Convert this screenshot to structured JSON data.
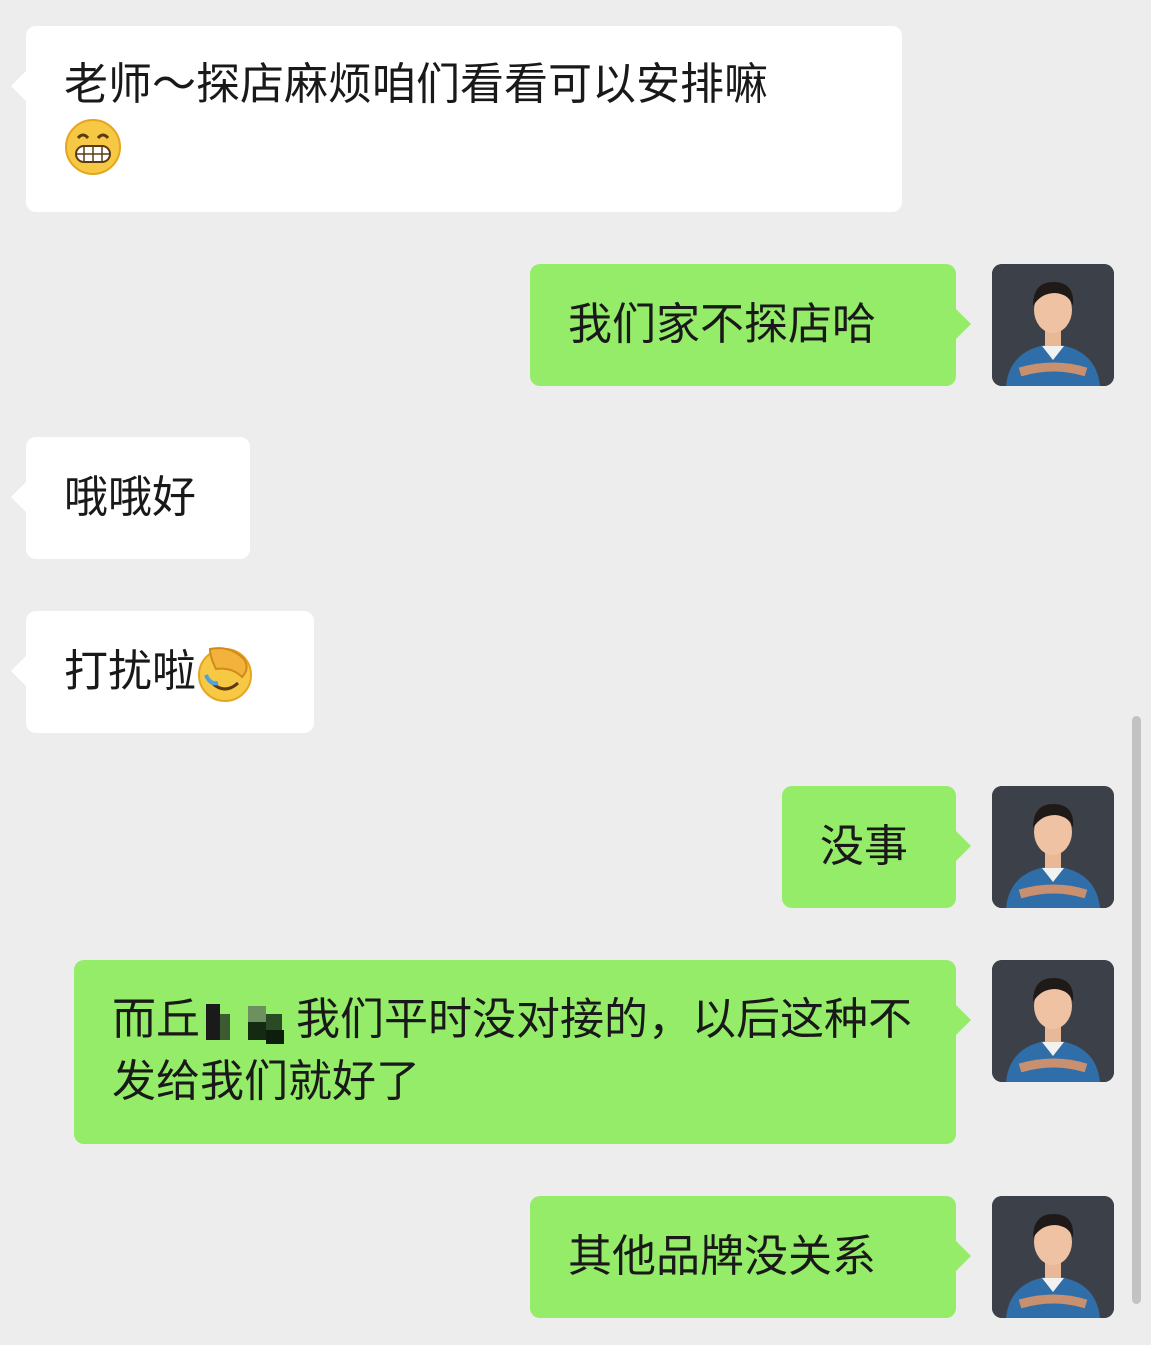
{
  "messages": [
    {
      "id": "m1",
      "direction": "in",
      "text": "老师～探店麻烦咱们看看可以安排嘛",
      "emoji": "grinning-face-emoji"
    },
    {
      "id": "m2",
      "direction": "out",
      "text": "我们家不探店哈"
    },
    {
      "id": "m3",
      "direction": "in",
      "text": "哦哦好"
    },
    {
      "id": "m4",
      "direction": "in",
      "text": "打扰啦",
      "emoji": "facepalm-emoji"
    },
    {
      "id": "m5",
      "direction": "out",
      "text": "没事"
    },
    {
      "id": "m6",
      "direction": "out",
      "text_prefix": "而丘",
      "text_suffix": "我们平时没对接的，以后这种不发给我们就好了",
      "redacted": true
    },
    {
      "id": "m7",
      "direction": "out",
      "text": "其他品牌没关系"
    }
  ],
  "colors": {
    "background": "#ededed",
    "incoming_bubble": "#ffffff",
    "outgoing_bubble": "#95ec69",
    "text": "#191919"
  }
}
